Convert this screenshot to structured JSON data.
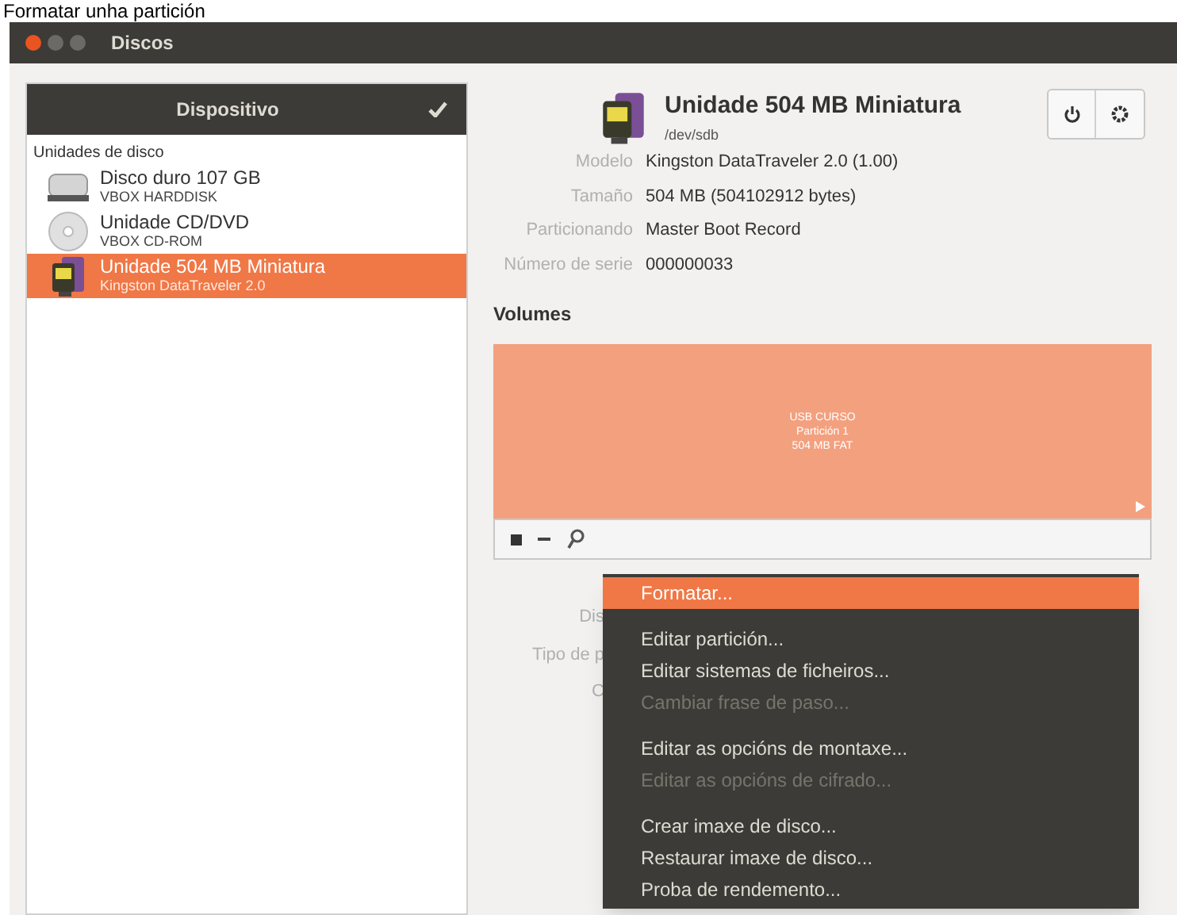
{
  "caption": "Formatar unha partición",
  "window": {
    "title": "Discos"
  },
  "sidebar": {
    "header": "Dispositivo",
    "header_checked": true,
    "section": "Unidades de disco",
    "items": [
      {
        "kind": "harddisk",
        "title": "Disco duro 107 GB",
        "subtitle": "VBOX HARDDISK",
        "selected": false
      },
      {
        "kind": "cdrom",
        "title": "Unidade CD/DVD",
        "subtitle": "VBOX CD-ROM",
        "selected": false
      },
      {
        "kind": "usb",
        "title": "Unidade 504 MB Miniatura",
        "subtitle": "Kingston DataTraveler 2.0",
        "selected": true
      }
    ]
  },
  "device": {
    "title": "Unidade 504 MB Miniatura",
    "path": "/dev/sdb",
    "properties": [
      {
        "label": "Modelo",
        "value": "Kingston DataTraveler 2.0 (1.00)"
      },
      {
        "label": "Tamaño",
        "value": "504 MB (504102912 bytes)"
      },
      {
        "label": "Particionando",
        "value": "Master Boot Record"
      },
      {
        "label": "Número de serie",
        "value": "000000033"
      }
    ]
  },
  "volumes": {
    "heading": "Volumes",
    "partition": [
      "USB CURSO",
      "Partición 1",
      "504 MB FAT"
    ],
    "hidden_labels": [
      "Dis",
      "Tipo de p",
      "C"
    ]
  },
  "menu": [
    {
      "label": "Formatar...",
      "selected": true,
      "disabled": false
    },
    {
      "kind": "separator"
    },
    {
      "label": "Editar partición...",
      "selected": false,
      "disabled": false
    },
    {
      "label": "Editar sistemas de ficheiros...",
      "selected": false,
      "disabled": false
    },
    {
      "label": "Cambiar frase de paso...",
      "selected": false,
      "disabled": true
    },
    {
      "kind": "separator"
    },
    {
      "label": "Editar as opcións de montaxe...",
      "selected": false,
      "disabled": false
    },
    {
      "label": "Editar as opcións de cifrado...",
      "selected": false,
      "disabled": true
    },
    {
      "kind": "separator"
    },
    {
      "label": "Crear imaxe de disco...",
      "selected": false,
      "disabled": false
    },
    {
      "label": "Restaurar imaxe de disco...",
      "selected": false,
      "disabled": false
    },
    {
      "label": "Proba de rendemento...",
      "selected": false,
      "disabled": false
    }
  ]
}
